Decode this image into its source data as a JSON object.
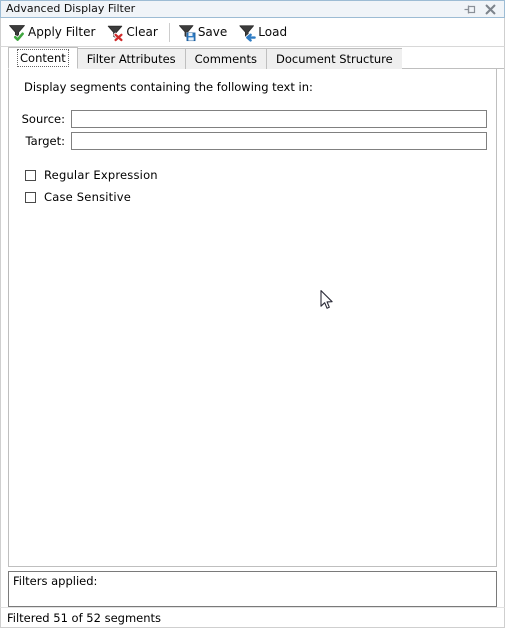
{
  "window": {
    "title": "Advanced Display Filter",
    "title_buttons": [
      {
        "name": "pin-icon",
        "label": "Pin"
      },
      {
        "name": "close-icon",
        "label": "Close"
      }
    ]
  },
  "toolbar": {
    "apply_filter_label": "Apply Filter",
    "clear_label": "Clear",
    "save_label": "Save",
    "load_label": "Load",
    "icons": {
      "apply_filter": "funnel-check-icon",
      "clear": "funnel-delete-icon",
      "save": "funnel-save-icon",
      "load": "funnel-load-icon"
    }
  },
  "tabs": {
    "active_index": 0,
    "items": [
      {
        "label": "Content"
      },
      {
        "label": "Filter Attributes"
      },
      {
        "label": "Comments"
      },
      {
        "label": "Document Structure"
      }
    ]
  },
  "content": {
    "intro": "Display segments containing the following text in:",
    "fields": [
      {
        "label": "Source:",
        "value": "",
        "placeholder": ""
      },
      {
        "label": "Target:",
        "value": "",
        "placeholder": ""
      }
    ],
    "checkboxes": [
      {
        "label": "Regular Expression",
        "checked": false
      },
      {
        "label": "Case Sensitive",
        "checked": false
      }
    ]
  },
  "filters_applied": {
    "label": "Filters applied:",
    "value": ""
  },
  "statusbar": {
    "text": "Filtered 51 of 52 segments"
  },
  "colors": {
    "titlebar_bg": "#f0f4f8",
    "titlebar_border": "#9dbcd4",
    "funnel_dark": "#3c3c3c",
    "check_green": "#3fa63f",
    "delete_red": "#d02b2b",
    "disk_blue": "#2f7cc4",
    "arrow_blue": "#2f7cc4",
    "tab_inactive_bg": "#efefef",
    "panel_border": "#bfbfbf",
    "field_border": "#808080"
  }
}
